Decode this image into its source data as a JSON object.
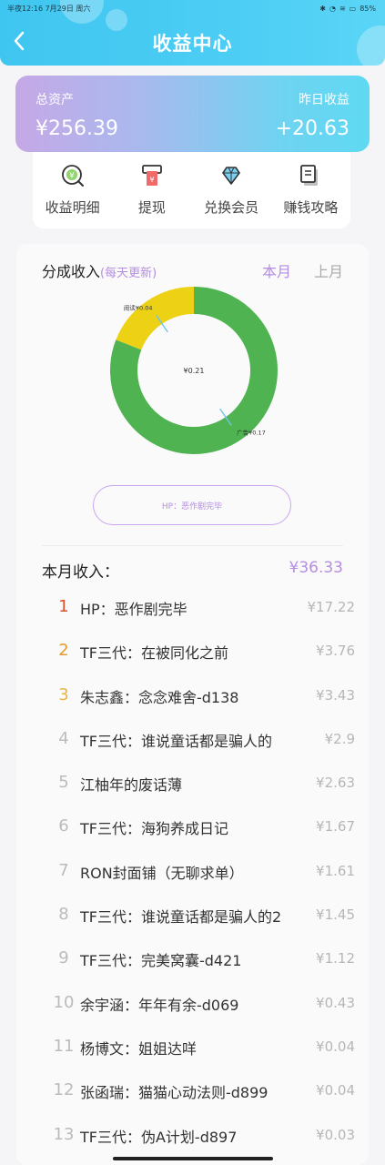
{
  "status_bar": {
    "time": "半夜12:16 7月29日 周六",
    "battery": "85%"
  },
  "header": {
    "title": "收益中心"
  },
  "assets": {
    "total_label": "总资产",
    "total_value": "¥256.39",
    "yesterday_label": "昨日收益",
    "yesterday_value": "+20.63"
  },
  "actions": [
    {
      "label": "收益明细",
      "icon": "coin-search-icon"
    },
    {
      "label": "提现",
      "icon": "withdraw-icon"
    },
    {
      "label": "兑换会员",
      "icon": "diamond-icon"
    },
    {
      "label": "赚钱攻略",
      "icon": "book-icon"
    }
  ],
  "share_income": {
    "title": "分成收入",
    "note": "(每天更新)",
    "tab_current": "本月",
    "tab_previous": "上月",
    "selected_work": "HP：恶作剧完毕"
  },
  "chart_data": {
    "type": "pie",
    "donut": true,
    "center_label": "¥0.21",
    "slices": [
      {
        "label": "阅读¥0.04",
        "value": 0.04,
        "color": "#ecd115"
      },
      {
        "label": "广告¥0.17",
        "value": 0.17,
        "color": "#4fb351"
      }
    ]
  },
  "monthly": {
    "label": "本月收入：",
    "total": "¥36.33",
    "items": [
      {
        "rank": "1",
        "name": "HP：恶作剧完毕",
        "amount": "¥17.22"
      },
      {
        "rank": "2",
        "name": "TF三代：在被同化之前",
        "amount": "¥3.76"
      },
      {
        "rank": "3",
        "name": "朱志鑫：念念难舍-d138",
        "amount": "¥3.43"
      },
      {
        "rank": "4",
        "name": "TF三代：谁说童话都是骗人的",
        "amount": "¥2.9"
      },
      {
        "rank": "5",
        "name": "江柚年的废话薄",
        "amount": "¥2.63"
      },
      {
        "rank": "6",
        "name": "TF三代：海狗养成日记",
        "amount": "¥1.67"
      },
      {
        "rank": "7",
        "name": "RON封面铺（无聊求单）",
        "amount": "¥1.61"
      },
      {
        "rank": "8",
        "name": "TF三代：谁说童话都是骗人的2",
        "amount": "¥1.45"
      },
      {
        "rank": "9",
        "name": "TF三代：完美窝囊-d421",
        "amount": "¥1.12"
      },
      {
        "rank": "10",
        "name": "余宇涵：年年有余-d069",
        "amount": "¥0.43"
      },
      {
        "rank": "11",
        "name": "杨博文：姐姐达咩",
        "amount": "¥0.04"
      },
      {
        "rank": "12",
        "name": "张函瑞：猫猫心动法则-d899",
        "amount": "¥0.04"
      },
      {
        "rank": "13",
        "name": "TF三代：伪A计划-d897",
        "amount": "¥0.03"
      }
    ]
  }
}
